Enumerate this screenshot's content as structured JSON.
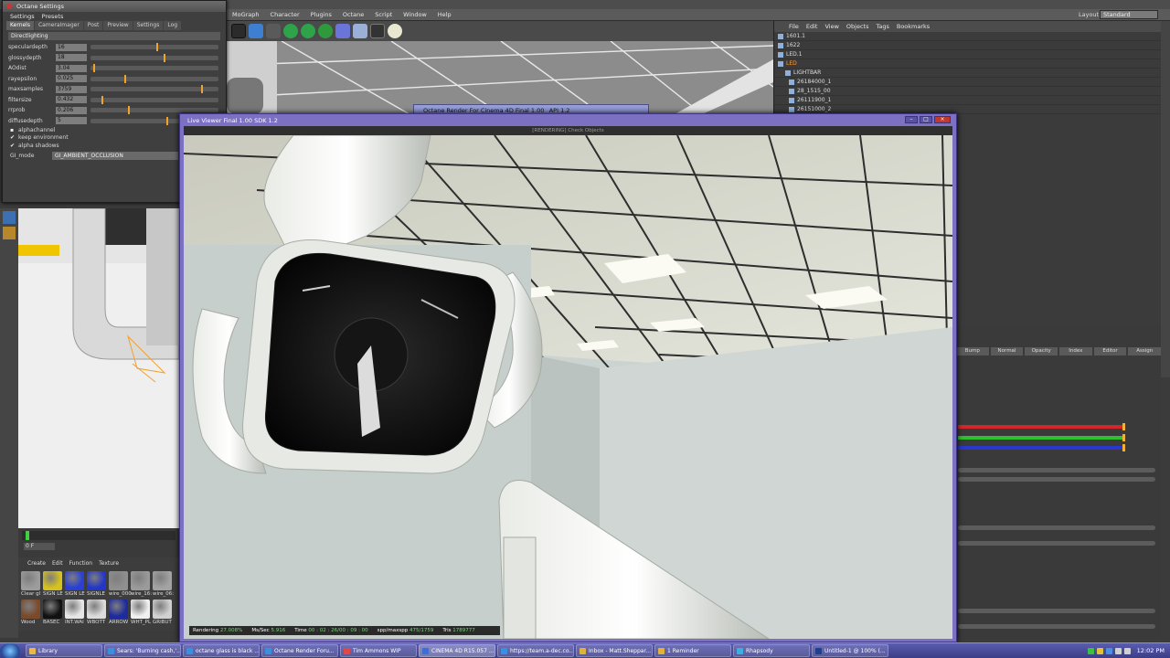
{
  "c4d": {
    "menu": [
      "MoGraph",
      "Character",
      "Plugins",
      "Octane",
      "Script",
      "Window",
      "Help"
    ],
    "layout_label": "Layout:",
    "layout_value": "Standard",
    "object_manager": {
      "menu": [
        "File",
        "Edit",
        "View",
        "Objects",
        "Tags",
        "Bookmarks"
      ],
      "rows": [
        {
          "name": "1601.1"
        },
        {
          "name": "1622"
        },
        {
          "name": "LED.1"
        },
        {
          "name": "LED",
          "selected": true
        },
        {
          "name": "LIGHTBAR"
        },
        {
          "name": "26184000_1"
        },
        {
          "name": "28_1515_00"
        },
        {
          "name": "26111900_1"
        },
        {
          "name": "26151000_2"
        }
      ]
    },
    "attr_tabs": [
      "Bump",
      "Normal",
      "Opacity",
      "Index",
      "Editor",
      "Assign"
    ],
    "material_menu": [
      "Create",
      "Edit",
      "Function",
      "Texture"
    ],
    "materials": [
      {
        "label": "Clear gl",
        "color": "#9c9c9c"
      },
      {
        "label": "SIGN LE",
        "color": "#d6c21c"
      },
      {
        "label": "SIGN LE",
        "color": "#2a3fd4"
      },
      {
        "label": "SIGNLE",
        "color": "#2436c7"
      },
      {
        "label": "wire_000",
        "color": "#8f8f8f"
      },
      {
        "label": "wire_16:",
        "color": "#9a9a9a"
      },
      {
        "label": "wire_06:",
        "color": "#a3a3a3"
      },
      {
        "label": "Wood",
        "color": "#7a4a2b"
      },
      {
        "label": "BASEC",
        "color": "#111111"
      },
      {
        "label": "INT.WAI",
        "color": "#e6e6e6"
      },
      {
        "label": "WBOTT",
        "color": "#dcdcdc"
      },
      {
        "label": "ARROW",
        "color": "#1e2b9e"
      },
      {
        "label": "WHT_PL",
        "color": "#f0f0f0"
      },
      {
        "label": "GRIBUT",
        "color": "#d0d0d0"
      }
    ],
    "timeline_field": "0 F"
  },
  "octane_settings": {
    "title": "Octane Settings",
    "menu": [
      "Settings",
      "Presets"
    ],
    "tabs": [
      "Kernels",
      "CameraImager",
      "Post",
      "Preview",
      "Settings",
      "Log"
    ],
    "section": "Directlighting",
    "params": [
      {
        "label": "speculardepth",
        "value": "16",
        "level": 0.52
      },
      {
        "label": "glossydepth",
        "value": "18",
        "level": 0.58
      },
      {
        "label": "AOdist",
        "value": "3.04",
        "level": 0.02
      },
      {
        "label": "rayepsilon",
        "value": "0.025",
        "level": 0.27
      },
      {
        "label": "maxsamples",
        "value": "3759",
        "level": 0.88
      },
      {
        "label": "filtersize",
        "value": "0.432",
        "level": 0.09
      },
      {
        "label": "rrprob",
        "value": "0.206",
        "level": 0.3
      },
      {
        "label": "diffusedepth",
        "value": "5",
        "level": 0.6
      }
    ],
    "checks": [
      {
        "label": "alphachannel",
        "checked": false
      },
      {
        "label": "keep environment",
        "checked": true
      },
      {
        "label": "alpha shadows",
        "checked": true
      }
    ],
    "gi_mode_label": "GI_mode",
    "gi_mode_value": "GI_AMBIENT_OCCLUSION"
  },
  "octane_render_window": {
    "title": "Octane Render For Cinema 4D Final 1.00 _API 1.2"
  },
  "live_viewer": {
    "title": "Live Viewer Final 1.00   SDK 1.2",
    "status": "[RENDERING] Check Objects",
    "stats": {
      "rendering_label": "Rendering",
      "rendering_value": "27.008%",
      "mss_label": "Ms/Sec",
      "mss_value": "5.916",
      "time_label": "Time",
      "time_value": "00 : 02 : 26/00 : 09 : 00",
      "spp_label": "spp/maxspp",
      "spp_value": "475/1759",
      "tris_label": "Tris",
      "tris_value": "1789777"
    }
  },
  "taskbar": {
    "tasks": [
      {
        "label": "Library",
        "color": "#e7b84a"
      },
      {
        "label": "Sears: 'Burning cash,'...",
        "color": "#3b8fe0"
      },
      {
        "label": "octane glass is black ...",
        "color": "#3b8fe0"
      },
      {
        "label": "Octane Render Foru...",
        "color": "#3b8fe0"
      },
      {
        "label": "Tim Ammons WIP",
        "color": "#e04848"
      },
      {
        "label": "CINEMA 4D R15.057 ...",
        "color": "#3a6fd6",
        "active": true
      },
      {
        "label": "https://team.a-dec.co...",
        "color": "#3b8fe0"
      },
      {
        "label": "Inbox - Matt.Sheppar...",
        "color": "#e0b23b"
      },
      {
        "label": "1 Reminder",
        "color": "#e0b23b"
      },
      {
        "label": "Rhapsody",
        "color": "#3bb0e0"
      },
      {
        "label": "Untitled-1 @ 100% (...",
        "color": "#1f3f8f"
      }
    ],
    "clock": "12:02 PM"
  }
}
